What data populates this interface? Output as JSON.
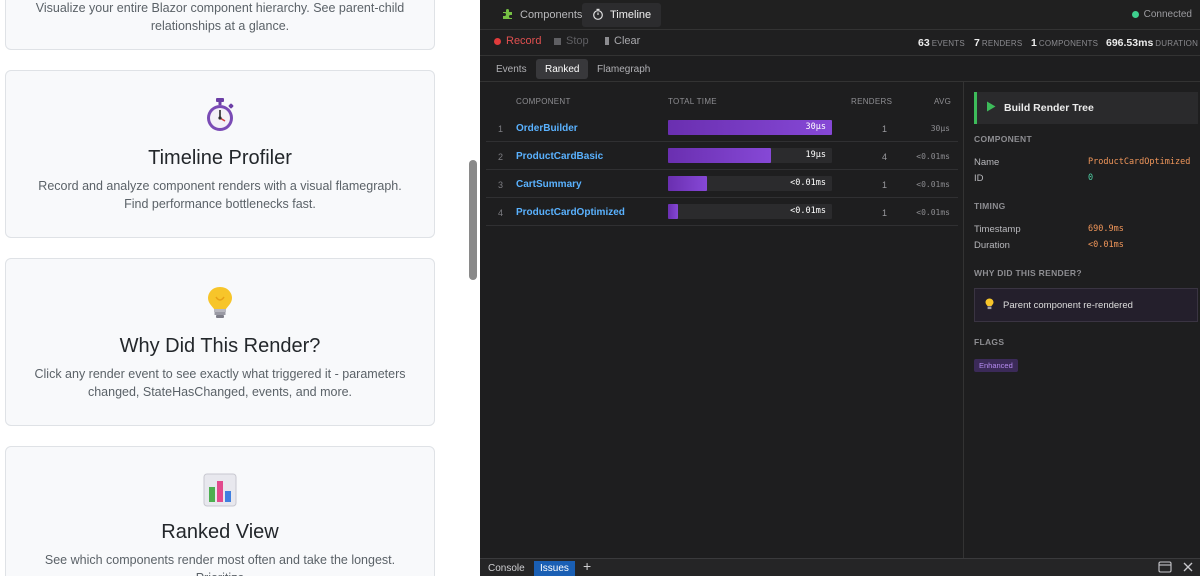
{
  "left_page": {
    "cards": [
      {
        "title": "",
        "description": "Visualize your entire Blazor component hierarchy. See parent-child relationships at a glance.",
        "icon": "tree-icon"
      },
      {
        "title": "Timeline Profiler",
        "description": "Record and analyze component renders with a visual flamegraph. Find performance bottlenecks fast.",
        "icon": "stopwatch-icon"
      },
      {
        "title": "Why Did This Render?",
        "description": "Click any render event to see exactly what triggered it - parameters changed, StateHasChanged, events, and more.",
        "icon": "lightbulb-icon"
      },
      {
        "title": "Ranked View",
        "description": "See which components render most often and take the longest. Prioritize",
        "icon": "bar-chart-icon"
      }
    ]
  },
  "devtools": {
    "tabs": [
      {
        "label": "Components",
        "icon": "puzzle-icon",
        "active": false
      },
      {
        "label": "Timeline",
        "icon": "stopwatch-icon",
        "active": true
      }
    ],
    "connection_status": "Connected",
    "toolbar": {
      "record_label": "Record",
      "stop_label": "Stop",
      "clear_label": "Clear"
    },
    "stats": {
      "events_value": "63",
      "events_label": "EVENTS",
      "renders_value": "7",
      "renders_label": "RENDERS",
      "components_value": "1",
      "components_label": "COMPONENTS",
      "duration_value": "696.53ms",
      "duration_label": "DURATION"
    },
    "view_tabs": [
      {
        "label": "Events",
        "active": false
      },
      {
        "label": "Ranked",
        "active": true
      },
      {
        "label": "Flamegraph",
        "active": false
      }
    ],
    "ranked_table": {
      "headers": {
        "component": "COMPONENT",
        "total_time": "TOTAL TIME",
        "renders": "RENDERS",
        "avg": "AVG"
      },
      "rows": [
        {
          "rank": "1",
          "component": "OrderBuilder",
          "total_time": "30μs",
          "bar_fraction": 1.0,
          "renders": "1",
          "avg": "30μs"
        },
        {
          "rank": "2",
          "component": "ProductCardBasic",
          "total_time": "19μs",
          "bar_fraction": 0.63,
          "renders": "4",
          "avg": "<0.01ms"
        },
        {
          "rank": "3",
          "component": "CartSummary",
          "total_time": "<0.01ms",
          "bar_fraction": 0.24,
          "renders": "1",
          "avg": "<0.01ms"
        },
        {
          "rank": "4",
          "component": "ProductCardOptimized",
          "total_time": "<0.01ms",
          "bar_fraction": 0.06,
          "renders": "1",
          "avg": "<0.01ms"
        }
      ]
    },
    "details": {
      "event_title": "Build Render Tree",
      "component_section": "COMPONENT",
      "name_label": "Name",
      "name_value": "ProductCardOptimized",
      "id_label": "ID",
      "id_value": "0",
      "timing_section": "TIMING",
      "timestamp_label": "Timestamp",
      "timestamp_value": "690.9ms",
      "duration_label": "Duration",
      "duration_value": "<0.01ms",
      "why_section": "WHY DID THIS RENDER?",
      "why_reason": "Parent component re-rendered",
      "flags_section": "FLAGS",
      "flag_badge": "Enhanced"
    },
    "drawer": {
      "tabs": [
        {
          "label": "Console",
          "active": false
        },
        {
          "label": "Issues",
          "active": true
        }
      ]
    },
    "colors": {
      "accent_purple": "#7b3fc9",
      "record_red": "#e03b3b",
      "link_blue": "#5ab2ff",
      "orange_value": "#f0965a",
      "connected_green": "#3ecf8e",
      "event_green": "#3dbb5a"
    }
  }
}
